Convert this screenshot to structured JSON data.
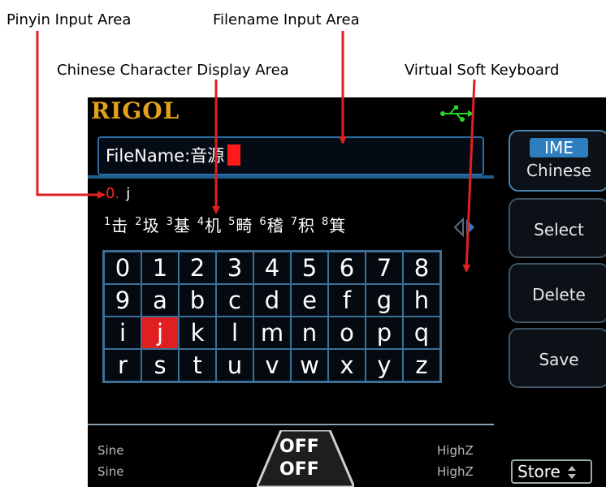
{
  "callouts": {
    "pinyin": "Pinyin Input Area",
    "filename": "Filename Input Area",
    "chinese": "Chinese Character Display Area",
    "keyboard": "Virtual Soft Keyboard"
  },
  "logo": "RIGOL",
  "filename_field": {
    "label": "FileName:",
    "value": "音源"
  },
  "pinyin_area": {
    "index": "0.",
    "text": "j"
  },
  "candidates": [
    {
      "num": "1",
      "char": "击"
    },
    {
      "num": "2",
      "char": "圾"
    },
    {
      "num": "3",
      "char": "基"
    },
    {
      "num": "4",
      "char": "机"
    },
    {
      "num": "5",
      "char": "畸"
    },
    {
      "num": "6",
      "char": "稽"
    },
    {
      "num": "7",
      "char": "积"
    },
    {
      "num": "8",
      "char": "箕"
    }
  ],
  "keyboard": {
    "keys": [
      "0",
      "1",
      "2",
      "3",
      "4",
      "5",
      "6",
      "7",
      "8",
      "9",
      "a",
      "b",
      "c",
      "d",
      "e",
      "f",
      "g",
      "h",
      "i",
      "j",
      "k",
      "l",
      "m",
      "n",
      "o",
      "p",
      "q",
      "r",
      "s",
      "t",
      "u",
      "v",
      "w",
      "x",
      "y",
      "z"
    ],
    "selected": "j"
  },
  "status": {
    "ch1_wave": "Sine",
    "ch2_wave": "Sine",
    "ch1_load": "HighZ",
    "ch2_load": "HighZ",
    "ch1_out": "OFF",
    "ch2_out": "OFF"
  },
  "softkeys": {
    "ime_label": "IME",
    "ime_value": "Chinese",
    "select": "Select",
    "delete": "Delete",
    "save": "Save",
    "store": "Store"
  },
  "colors": {
    "accent": "#2f7fc0",
    "selected_key": "#e02020",
    "logo": "#e3a21a",
    "arrow": "#e02020"
  },
  "icons": [
    "usb-icon",
    "candidate-page-arrows-icon",
    "store-updown-icon"
  ]
}
